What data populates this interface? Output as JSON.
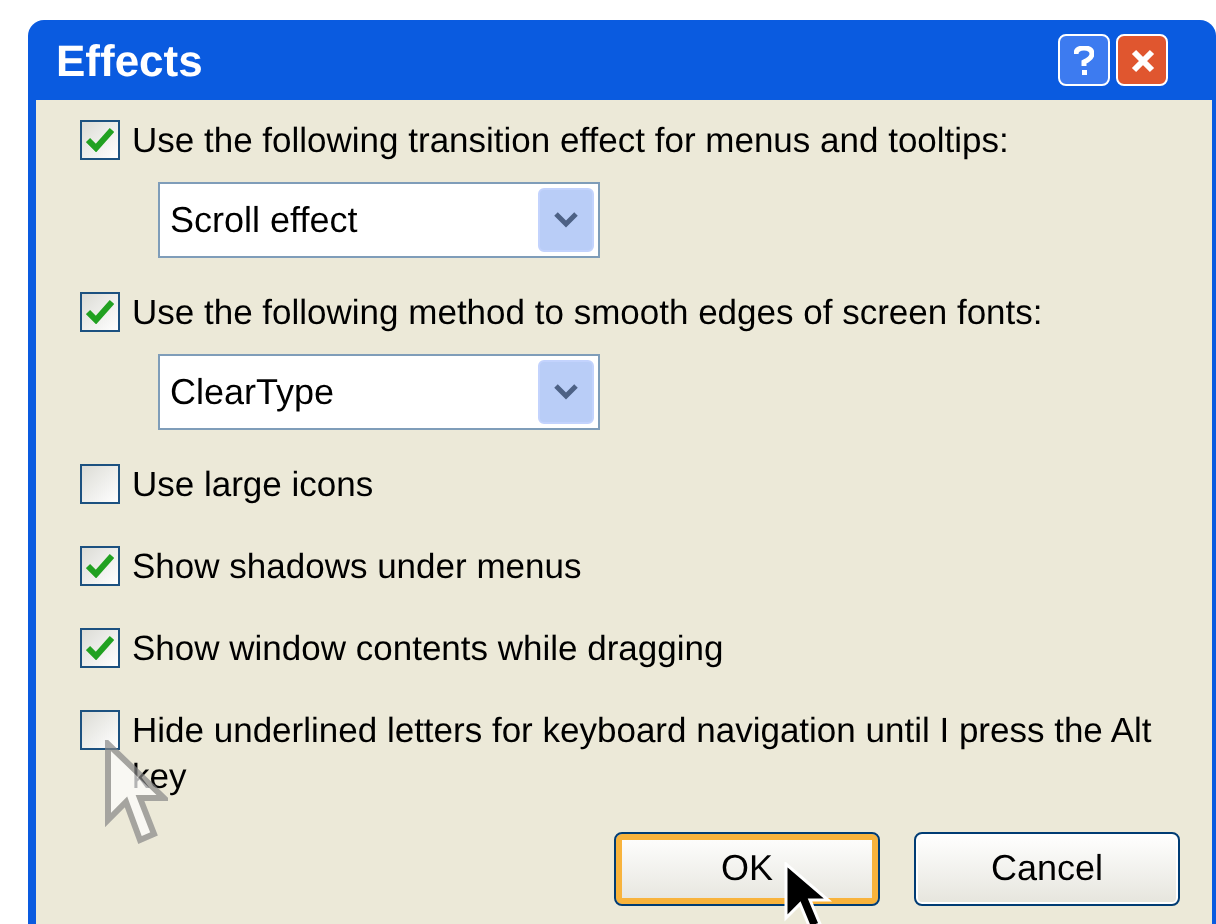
{
  "window": {
    "title": "Effects"
  },
  "items": [
    {
      "kind": "checkbox",
      "label": "Use the following transition effect for menus and tooltips:",
      "checked": true
    },
    {
      "kind": "dropdown",
      "value": "Scroll effect"
    },
    {
      "kind": "checkbox",
      "label": "Use the following method to smooth edges of screen fonts:",
      "checked": true
    },
    {
      "kind": "dropdown",
      "value": "ClearType"
    },
    {
      "kind": "checkbox",
      "label": "Use large icons",
      "checked": false
    },
    {
      "kind": "checkbox",
      "label": "Show shadows under menus",
      "checked": true
    },
    {
      "kind": "checkbox",
      "label": "Show window contents while dragging",
      "checked": true
    },
    {
      "kind": "checkbox",
      "label": "Hide underlined letters for keyboard navigation until I press the Alt key",
      "checked": false
    }
  ],
  "buttons": [
    {
      "label": "OK",
      "default": true
    },
    {
      "label": "Cancel",
      "default": false
    }
  ]
}
